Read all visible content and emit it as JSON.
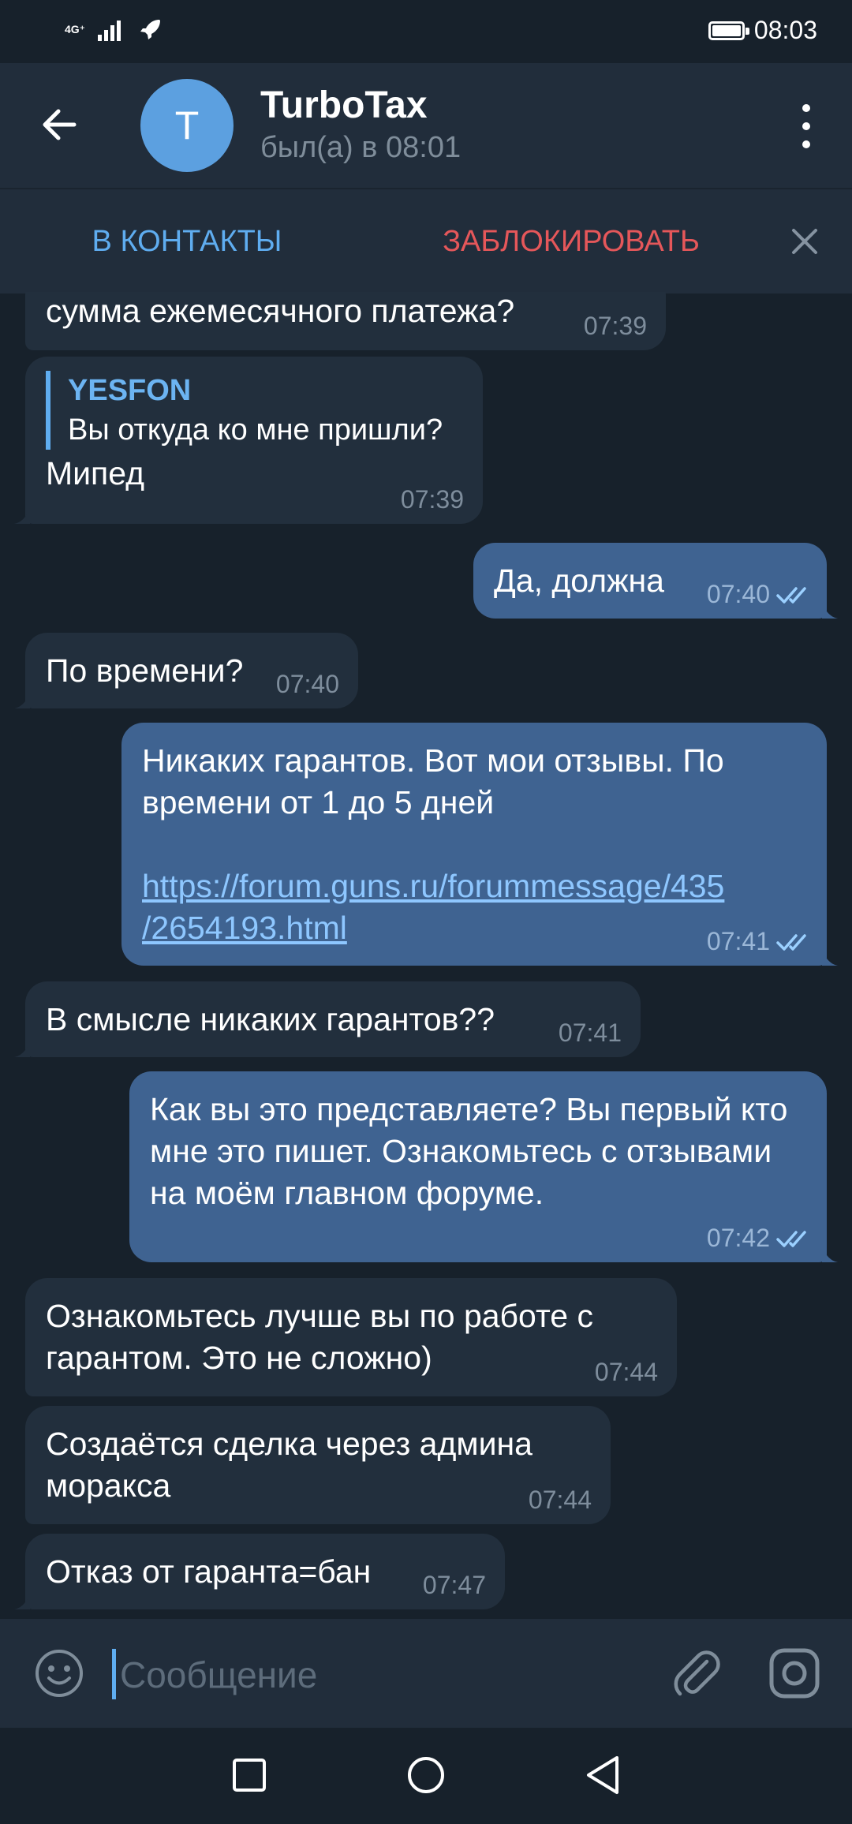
{
  "status_bar": {
    "network": "4G⁺",
    "time": "08:03"
  },
  "header": {
    "avatar_letter": "T",
    "title": "TurboTax",
    "last_seen": "был(а) в 08:01"
  },
  "action_bar": {
    "add_contact": "В КОНТАКТЫ",
    "block": "ЗАБЛОКИРОВАТЬ"
  },
  "messages": [
    {
      "dir": "in",
      "text": "сумма ежемесячного платежа?",
      "time": "07:39"
    },
    {
      "dir": "in",
      "reply_name": "YESFON",
      "reply_text": "Вы откуда ко мне пришли?",
      "text": "Мипед",
      "time": "07:39"
    },
    {
      "dir": "out",
      "text": "Да, должна",
      "time": "07:40"
    },
    {
      "dir": "in",
      "text": "По времени?",
      "time": "07:40"
    },
    {
      "dir": "out",
      "text": "Никаких гарантов. Вот мои отзывы. По времени от 1 до 5 дней",
      "link": "https://forum.guns.ru/forummessage/435/2654193.html",
      "link_line1": "https://forum.guns.ru/forummessage/435",
      "link_line2": "/2654193.html",
      "time": "07:41"
    },
    {
      "dir": "in",
      "text": "В смысле никаких гарантов??",
      "time": "07:41"
    },
    {
      "dir": "out",
      "text": "Как вы это представляете? Вы первый кто мне это пишет. Ознакомьтесь с отзывами на моём главном форуме.",
      "time": "07:42"
    },
    {
      "dir": "in",
      "text": "Ознакомьтесь лучше вы по работе с гарантом. Это не сложно)",
      "time": "07:44"
    },
    {
      "dir": "in",
      "text": "Создаётся сделка через админа моракса",
      "time": "07:44"
    },
    {
      "dir": "in",
      "text": "Отказ от гаранта=бан",
      "time": "07:47"
    }
  ],
  "composer": {
    "placeholder": "Сообщение"
  },
  "icons": {
    "back": "arrow-left-icon",
    "menu": "more-vertical-icon",
    "close": "close-icon",
    "emoji": "emoji-icon",
    "attach": "paperclip-icon",
    "camera": "camera-icon",
    "read": "double-check-icon"
  },
  "colors": {
    "background": "#17212b",
    "header": "#212d3b",
    "incoming": "#222f3d",
    "outgoing": "#3f6391",
    "accent": "#5fadf0",
    "danger": "#e5575a",
    "avatar": "#5ca0e0"
  }
}
